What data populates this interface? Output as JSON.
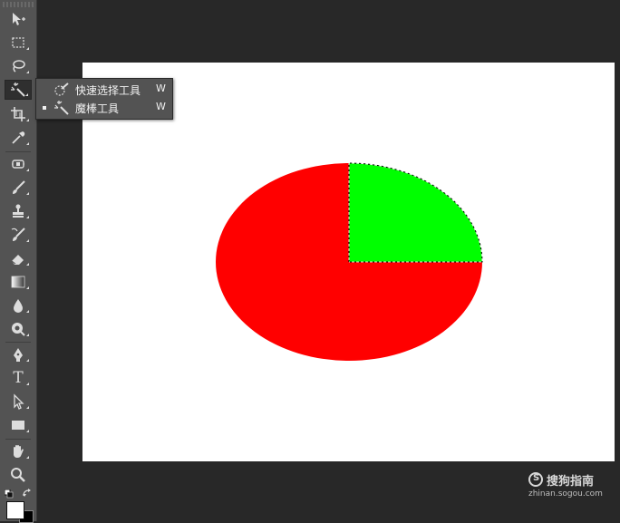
{
  "toolbar": {
    "tools": [
      {
        "name": "move-tool",
        "icon": "move-icon"
      },
      {
        "name": "rectangular-marquee-tool",
        "icon": "marquee-icon"
      },
      {
        "name": "lasso-tool",
        "icon": "lasso-icon"
      },
      {
        "name": "magic-wand-tool",
        "icon": "magic-wand-icon",
        "active": true
      },
      {
        "name": "crop-tool",
        "icon": "crop-icon"
      },
      {
        "name": "eyedropper-tool",
        "icon": "eyedropper-icon"
      },
      {
        "name": "spot-healing-tool",
        "icon": "bandage-icon"
      },
      {
        "name": "brush-tool",
        "icon": "brush-icon"
      },
      {
        "name": "clone-stamp-tool",
        "icon": "stamp-icon"
      },
      {
        "name": "history-brush-tool",
        "icon": "history-brush-icon"
      },
      {
        "name": "eraser-tool",
        "icon": "eraser-icon"
      },
      {
        "name": "gradient-tool",
        "icon": "gradient-icon"
      },
      {
        "name": "blur-tool",
        "icon": "drop-icon"
      },
      {
        "name": "dodge-tool",
        "icon": "dodge-icon"
      },
      {
        "name": "pen-tool",
        "icon": "pen-icon"
      },
      {
        "name": "type-tool",
        "icon": "type-icon",
        "glyph": "T"
      },
      {
        "name": "path-selection-tool",
        "icon": "arrow-icon"
      },
      {
        "name": "rectangle-tool",
        "icon": "rectangle-icon"
      },
      {
        "name": "hand-tool",
        "icon": "hand-icon"
      },
      {
        "name": "zoom-tool",
        "icon": "zoom-icon"
      }
    ],
    "foreground_color": "#ffffff",
    "background_color": "#000000"
  },
  "flyout": {
    "items": [
      {
        "label": "快速选择工具",
        "shortcut": "W",
        "icon": "quick-selection-icon",
        "selected": false
      },
      {
        "label": "魔棒工具",
        "shortcut": "W",
        "icon": "magic-wand-icon",
        "selected": true
      }
    ]
  },
  "canvas": {
    "background": "#ffffff",
    "ellipse_fill": "#ff0000",
    "selected_quadrant_fill": "#00ff00",
    "selection": "marching-ants"
  },
  "watermark": {
    "logo_glyph": "S",
    "brand": "搜狗指南",
    "url": "zhinan.sogou.com"
  }
}
